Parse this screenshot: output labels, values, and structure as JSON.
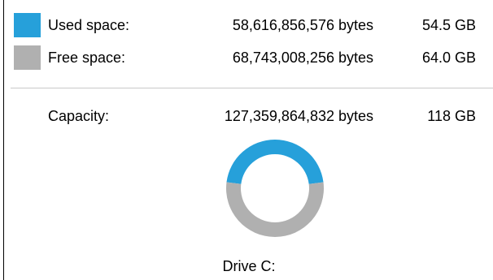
{
  "colors": {
    "used": "#26a0da",
    "free": "#b0b0b0",
    "divider": "#c8c8c8"
  },
  "used": {
    "label": "Used space:",
    "bytes": "58,616,856,576 bytes",
    "size": "54.5 GB"
  },
  "free": {
    "label": "Free space:",
    "bytes": "68,743,008,256 bytes",
    "size": "64.0 GB"
  },
  "capacity": {
    "label": "Capacity:",
    "bytes": "127,359,864,832 bytes",
    "size": "118 GB"
  },
  "chart_data": {
    "type": "pie",
    "categories": [
      "Used space",
      "Free space"
    ],
    "values": [
      58616856576,
      68743008256
    ]
  },
  "drive": {
    "label": "Drive C:"
  }
}
